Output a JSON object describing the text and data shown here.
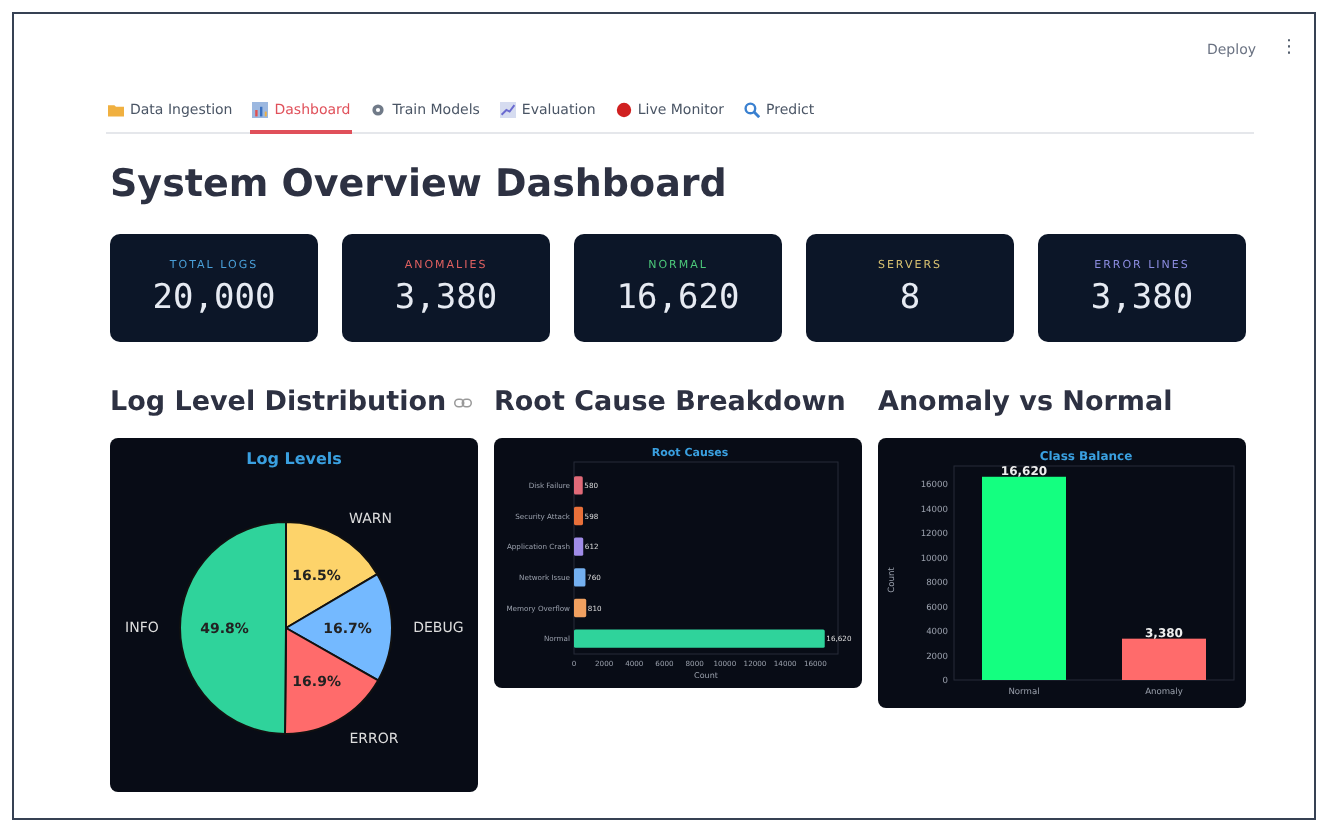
{
  "header": {
    "deploy": "Deploy",
    "menu": "⋮"
  },
  "tabs": [
    {
      "label": "Data Ingestion",
      "selected": false
    },
    {
      "label": "Dashboard",
      "selected": true
    },
    {
      "label": "Train Models",
      "selected": false
    },
    {
      "label": "Evaluation",
      "selected": false
    },
    {
      "label": "Live Monitor",
      "selected": false
    },
    {
      "label": "Predict",
      "selected": false
    }
  ],
  "title": "System Overview Dashboard",
  "metrics": [
    {
      "label": "TOTAL LOGS",
      "value": "20,000",
      "color": "#4a9fd8"
    },
    {
      "label": "ANOMALIES",
      "value": "3,380",
      "color": "#e06060"
    },
    {
      "label": "NORMAL",
      "value": "16,620",
      "color": "#4cc77a"
    },
    {
      "label": "SERVERS",
      "value": "8",
      "color": "#d8c070"
    },
    {
      "label": "ERROR LINES",
      "value": "3,380",
      "color": "#8c8ce0"
    }
  ],
  "sections": [
    {
      "heading": "Log Level Distribution",
      "link": true,
      "chart_data": {
        "type": "pie",
        "title": "Log Levels",
        "categories": [
          "WARN",
          "DEBUG",
          "ERROR",
          "INFO"
        ],
        "values": [
          16.5,
          16.7,
          16.9,
          49.8
        ],
        "colors": [
          "#fdd36a",
          "#74b9ff",
          "#ff6b6b",
          "#2fd39b"
        ],
        "value_labels": [
          "16.5%",
          "16.7%",
          "16.9%",
          "49.8%"
        ]
      }
    },
    {
      "heading": "Root Cause Breakdown",
      "chart_data": {
        "type": "bar",
        "orientation": "horizontal",
        "title": "Root Causes",
        "xlabel": "Count",
        "categories": [
          "Disk Failure",
          "Security Attack",
          "Application Crash",
          "Network Issue",
          "Memory Overflow",
          "Normal"
        ],
        "values": [
          580,
          598,
          612,
          760,
          810,
          16620
        ],
        "colors": [
          "#e06a78",
          "#e8703a",
          "#a08ce8",
          "#74b0f0",
          "#f0a060",
          "#2fd39b"
        ],
        "xlim": [
          0,
          17500
        ],
        "xticks": [
          0,
          2000,
          4000,
          6000,
          8000,
          10000,
          12000,
          14000,
          16000
        ],
        "value_labels": [
          "580",
          "598",
          "612",
          "760",
          "810",
          "16,620"
        ]
      }
    },
    {
      "heading": "Anomaly vs Normal",
      "chart_data": {
        "type": "bar",
        "orientation": "vertical",
        "title": "Class Balance",
        "ylabel": "Count",
        "categories": [
          "Normal",
          "Anomaly"
        ],
        "values": [
          16620,
          3380
        ],
        "colors": [
          "#14ff80",
          "#ff6b6b"
        ],
        "ylim": [
          0,
          17500
        ],
        "yticks": [
          0,
          2000,
          4000,
          6000,
          8000,
          10000,
          12000,
          14000,
          16000
        ],
        "value_labels": [
          "16,620",
          "3,380"
        ]
      }
    }
  ]
}
